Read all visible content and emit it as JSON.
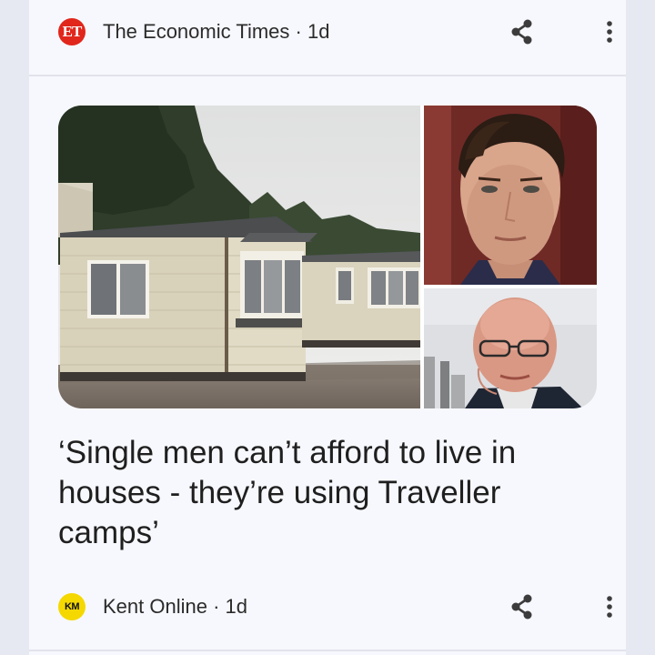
{
  "top_card": {
    "source": {
      "logo_text": "ET",
      "logo_color": "#e1261c",
      "name": "The Economic Times · 1d",
      "share_icon": "share-icon",
      "more_icon": "more-vertical-icon"
    }
  },
  "article": {
    "images": [
      "mobile-homes-photo",
      "man-portrait-photo",
      "older-man-portrait-photo"
    ],
    "headline": "‘Single men can’t afford to live in houses - they’re using Traveller camps’",
    "source": {
      "logo_text": "KM",
      "logo_color": "#f5d800",
      "name": "Kent Online · 1d",
      "share_icon": "share-icon",
      "more_icon": "more-vertical-icon"
    }
  }
}
